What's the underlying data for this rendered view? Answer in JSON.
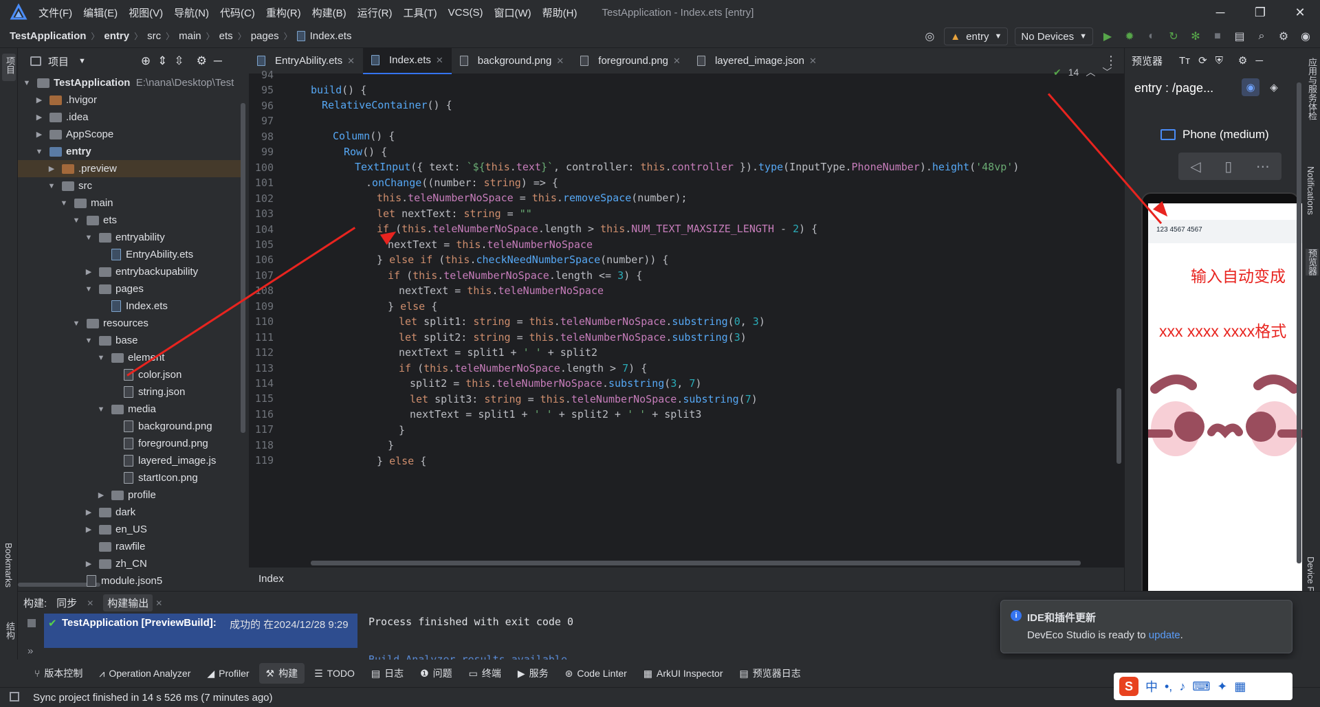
{
  "app": {
    "title": "TestApplication - Index.ets [entry]"
  },
  "menu": [
    "文件(F)",
    "编辑(E)",
    "视图(V)",
    "导航(N)",
    "代码(C)",
    "重构(R)",
    "构建(B)",
    "运行(R)",
    "工具(T)",
    "VCS(S)",
    "窗口(W)",
    "帮助(H)"
  ],
  "breadcrumb": [
    "TestApplication",
    "entry",
    "src",
    "main",
    "ets",
    "pages",
    "Index.ets"
  ],
  "toolbar": {
    "module": "entry",
    "device": "No Devices"
  },
  "project": {
    "title": "项目",
    "root": "TestApplication",
    "root_path": "E:\\nana\\Desktop\\Test",
    "items": [
      {
        "label": ".hvigor",
        "kind": "folder-orange"
      },
      {
        "label": ".idea",
        "kind": "folder"
      },
      {
        "label": "AppScope",
        "kind": "folder"
      },
      {
        "label": "entry",
        "kind": "folder-blue"
      },
      {
        "label": ".preview",
        "kind": "folder-orange"
      },
      {
        "label": "src",
        "kind": "folder"
      },
      {
        "label": "main",
        "kind": "folder"
      },
      {
        "label": "ets",
        "kind": "folder"
      },
      {
        "label": "entryability",
        "kind": "folder"
      },
      {
        "label": "EntryAbility.ets",
        "kind": "file"
      },
      {
        "label": "entrybackupability",
        "kind": "folder"
      },
      {
        "label": "pages",
        "kind": "folder"
      },
      {
        "label": "Index.ets",
        "kind": "file"
      },
      {
        "label": "resources",
        "kind": "folder"
      },
      {
        "label": "base",
        "kind": "folder"
      },
      {
        "label": "element",
        "kind": "folder"
      },
      {
        "label": "color.json",
        "kind": "json"
      },
      {
        "label": "string.json",
        "kind": "json"
      },
      {
        "label": "media",
        "kind": "folder"
      },
      {
        "label": "background.png",
        "kind": "json"
      },
      {
        "label": "foreground.png",
        "kind": "json"
      },
      {
        "label": "layered_image.js",
        "kind": "json"
      },
      {
        "label": "startIcon.png",
        "kind": "json"
      },
      {
        "label": "profile",
        "kind": "folder"
      },
      {
        "label": "dark",
        "kind": "folder"
      },
      {
        "label": "en_US",
        "kind": "folder"
      },
      {
        "label": "rawfile",
        "kind": "folder"
      },
      {
        "label": "zh_CN",
        "kind": "folder"
      },
      {
        "label": "module.json5",
        "kind": "json"
      }
    ]
  },
  "tabs": [
    "EntryAbility.ets",
    "Index.ets",
    "background.png",
    "foreground.png",
    "layered_image.json"
  ],
  "editor": {
    "line_numbers": [
      "94",
      "95",
      "96",
      "97",
      "98",
      "99",
      "100",
      "101",
      "102",
      "103",
      "104",
      "105",
      "106",
      "107",
      "108",
      "109",
      "110",
      "111",
      "112",
      "113",
      "114",
      "115",
      "116",
      "117",
      "118",
      "119"
    ],
    "inspection_count": "14",
    "footer": "Index"
  },
  "preview": {
    "title": "预览器",
    "page": "entry : /page...",
    "device": "Phone (medium)",
    "phone_text": "123 4567 4567",
    "annotation1": "输入自动变成",
    "annotation2": "xxx xxxx xxxx格式"
  },
  "build": {
    "label": "构建:",
    "tab_sync": "同步",
    "tab_output": "构建输出",
    "task": "TestApplication [PreviewBuild]:",
    "task_result": "成功的 在2024/12/28 9:29",
    "output_line1": "Process finished with exit code 0",
    "output_line2": "Build Analyzer results available"
  },
  "notification": {
    "title": "IDE和插件更新",
    "text": "DevEco Studio is ready to ",
    "link": "update",
    "end": "."
  },
  "bottom_tools": [
    "版本控制",
    "Operation Analyzer",
    "Profiler",
    "构建",
    "TODO",
    "日志",
    "问题",
    "终端",
    "服务",
    "Code Linter",
    "ArkUI Inspector",
    "预览器日志"
  ],
  "status": "Sync project finished in 14 s 526 ms (7 minutes ago)",
  "left_strip": [
    "项目",
    "Bookmarks",
    "结构"
  ],
  "right_strip": [
    "应用与服务体检",
    "Notifications",
    "预览器",
    "Device File Browser"
  ]
}
